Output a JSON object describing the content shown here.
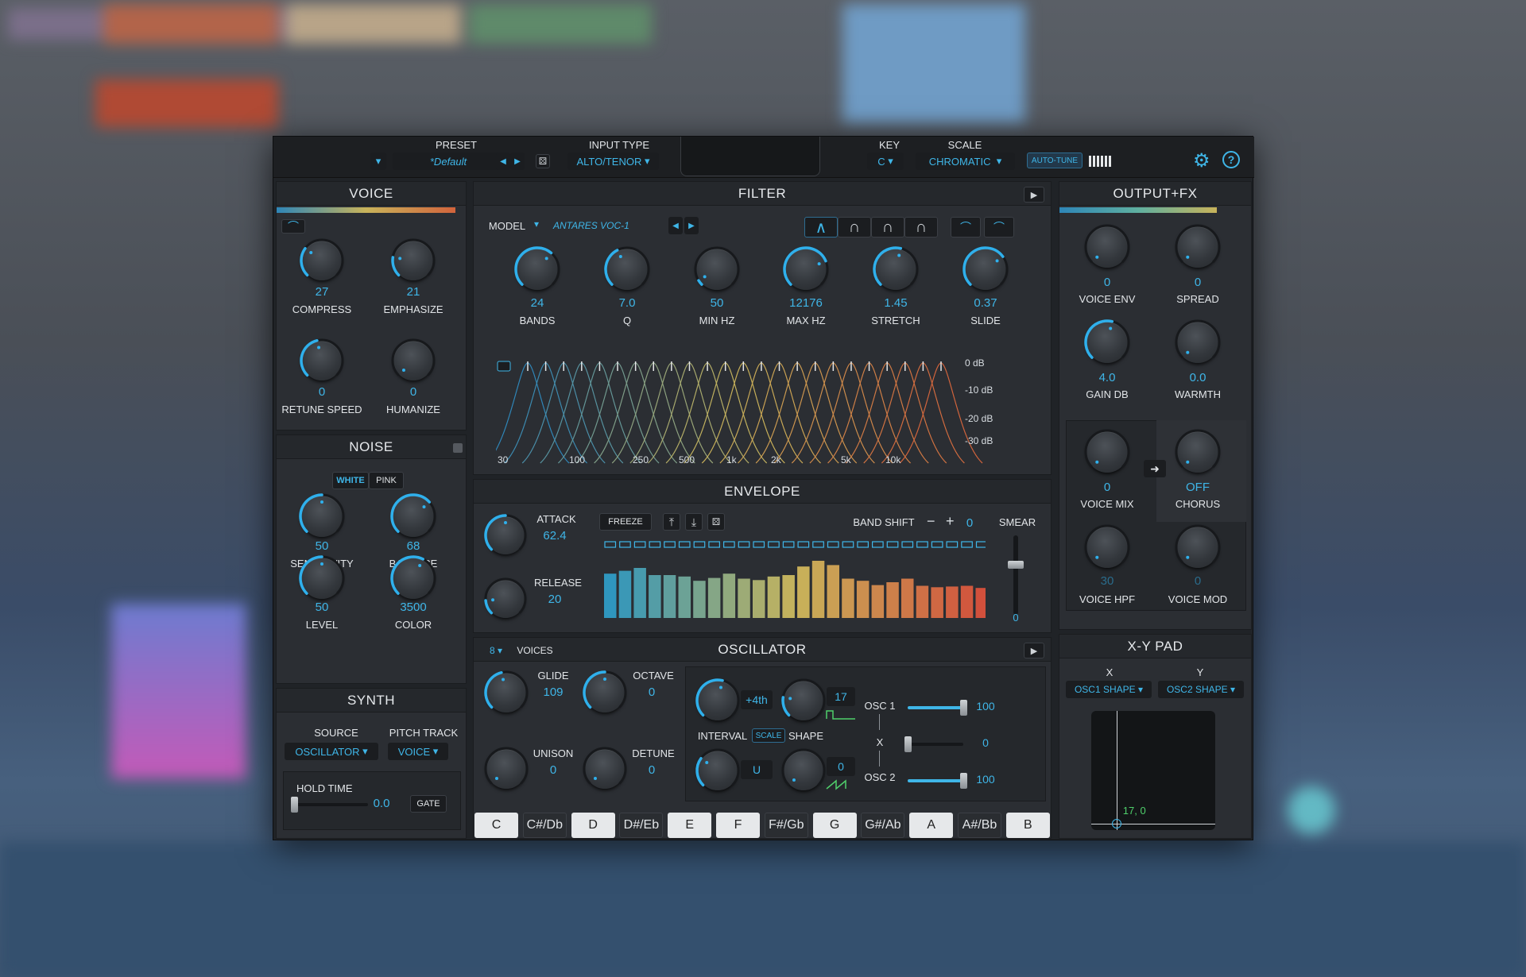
{
  "top": {
    "preset_label": "PRESET",
    "preset_value": "*Default",
    "input_type_label": "INPUT TYPE",
    "input_type_value": "ALTO/TENOR",
    "key_label": "KEY",
    "key_value": "C",
    "scale_label": "SCALE",
    "scale_value": "CHROMATIC",
    "autotune": "AUTO-TUNE"
  },
  "voice": {
    "title": "VOICE",
    "knobs": [
      {
        "label": "COMPRESS",
        "value": "27",
        "level": 0.3
      },
      {
        "label": "EMPHASIZE",
        "value": "21",
        "level": 0.2
      },
      {
        "label": "RETUNE SPEED",
        "value": "0",
        "level": 0.45
      },
      {
        "label": "HUMANIZE",
        "value": "0",
        "level": 0
      }
    ]
  },
  "noise": {
    "title": "NOISE",
    "white": "WHITE",
    "pink": "PINK",
    "knobs": [
      {
        "label": "SENSITIVITY",
        "value": "50",
        "level": 0.5
      },
      {
        "label": "BALANCE",
        "value": "68",
        "level": 0.68
      },
      {
        "label": "LEVEL",
        "value": "50",
        "level": 0.5
      },
      {
        "label": "COLOR",
        "value": "3500",
        "level": 0.6
      }
    ]
  },
  "synth": {
    "title": "SYNTH",
    "source_label": "SOURCE",
    "source_value": "OSCILLATOR",
    "pitch_label": "PITCH TRACK",
    "pitch_value": "VOICE",
    "hold_label": "HOLD TIME",
    "hold_value": "0.0",
    "gate": "GATE"
  },
  "filter": {
    "title": "FILTER",
    "model_label": "MODEL",
    "model_value": "ANTARES VOC-1",
    "knobs": [
      {
        "label": "BANDS",
        "value": "24",
        "level": 0.65
      },
      {
        "label": "Q",
        "value": "7.0",
        "level": 0.4
      },
      {
        "label": "MIN HZ",
        "value": "50",
        "level": 0.05
      },
      {
        "label": "MAX HZ",
        "value": "12176",
        "level": 0.75
      },
      {
        "label": "STRETCH",
        "value": "1.45",
        "level": 0.55
      },
      {
        "label": "SLIDE",
        "value": "0.37",
        "level": 0.7
      }
    ],
    "db_labels": [
      "0 dB",
      "-10 dB",
      "-20 dB",
      "-30 dB"
    ],
    "hz_labels": [
      "30",
      "100",
      "250",
      "500",
      "1k",
      "2k",
      "5k",
      "10k"
    ]
  },
  "envelope": {
    "title": "ENVELOPE",
    "attack_label": "ATTACK",
    "attack_value": "62.4",
    "attack_level": 0.5,
    "release_label": "RELEASE",
    "release_value": "20",
    "release_level": 0.15,
    "freeze": "FREEZE",
    "band_shift_label": "BAND SHIFT",
    "band_shift_value": "0",
    "smear_label": "SMEAR",
    "smear_value": "0",
    "bars": [
      0.62,
      0.66,
      0.7,
      0.6,
      0.6,
      0.58,
      0.52,
      0.56,
      0.62,
      0.55,
      0.53,
      0.58,
      0.6,
      0.72,
      0.8,
      0.74,
      0.55,
      0.52,
      0.46,
      0.5,
      0.55,
      0.45,
      0.43,
      0.44,
      0.45,
      0.42
    ]
  },
  "osc": {
    "title": "OSCILLATOR",
    "voices_value": "8",
    "voices_label": "VOICES",
    "glide_label": "GLIDE",
    "glide_value": "109",
    "glide_level": 0.45,
    "octave_label": "OCTAVE",
    "octave_value": "0",
    "octave_level": 0.5,
    "unison_label": "UNISON",
    "unison_value": "0",
    "unison_level": 0,
    "detune_label": "DETUNE",
    "detune_value": "0",
    "detune_level": 0,
    "interval_label": "INTERVAL",
    "interval_value": "+4th",
    "interval_level": 0.55,
    "scale_btn": "SCALE",
    "interval2_value": "U",
    "interval2_level": 0.3,
    "shape_label": "SHAPE",
    "shape_value": "17",
    "shape_level": 0.2,
    "shape2_value": "0",
    "shape2_level": 0,
    "osc1_label": "OSC 1",
    "osc1_value": "100",
    "osc1_level": 1.0,
    "x_label": "X",
    "x_value": "0",
    "x_level": 0,
    "osc2_label": "OSC 2",
    "osc2_value": "100",
    "osc2_level": 1.0
  },
  "keys": [
    {
      "label": "C",
      "white": true
    },
    {
      "label": "C#/Db",
      "white": false
    },
    {
      "label": "D",
      "white": true
    },
    {
      "label": "D#/Eb",
      "white": false
    },
    {
      "label": "E",
      "white": true
    },
    {
      "label": "F",
      "white": true
    },
    {
      "label": "F#/Gb",
      "white": false
    },
    {
      "label": "G",
      "white": true
    },
    {
      "label": "G#/Ab",
      "white": false
    },
    {
      "label": "A",
      "white": true
    },
    {
      "label": "A#/Bb",
      "white": false
    },
    {
      "label": "B",
      "white": true
    }
  ],
  "output": {
    "title": "OUTPUT+FX",
    "knobs": [
      {
        "label": "VOICE  ENV",
        "value": "0",
        "level": 0
      },
      {
        "label": "SPREAD",
        "value": "0",
        "level": 0
      },
      {
        "label": "GAIN DB",
        "value": "4.0",
        "level": 0.55
      },
      {
        "label": "WARMTH",
        "value": "0.0",
        "level": 0
      },
      {
        "label": "VOICE MIX",
        "value": "0",
        "level": 0
      },
      {
        "label": "CHORUS",
        "value": "OFF",
        "level": 0
      },
      {
        "label": "VOICE HPF",
        "value": "30",
        "level": 0
      },
      {
        "label": "VOICE MOD",
        "value": "0",
        "level": 0
      }
    ]
  },
  "xy": {
    "title": "X-Y PAD",
    "x_label": "X",
    "y_label": "Y",
    "x_value": "OSC1 SHAPE",
    "y_value": "OSC2 SHAPE",
    "readout": "17, 0",
    "point_x": 0.17,
    "point_y": 0
  }
}
